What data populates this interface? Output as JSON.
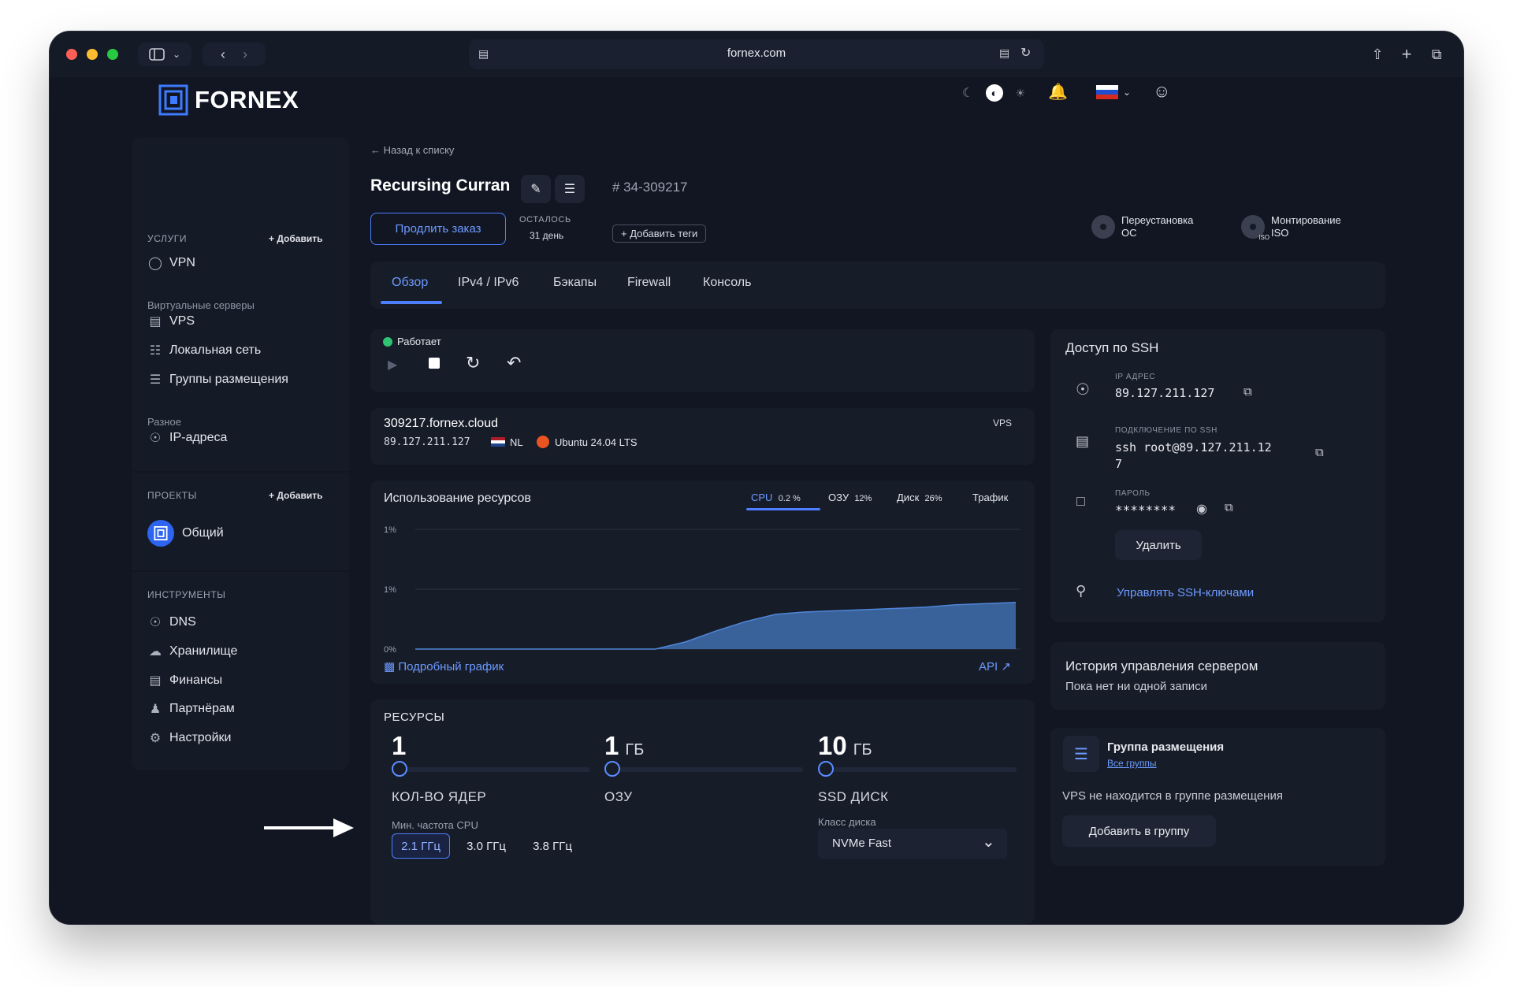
{
  "browser": {
    "url": "fornex.com"
  },
  "brand": {
    "name": "FORNEX"
  },
  "sidebar": {
    "services_head": "УСЛУГИ",
    "services_add": "+ Добавить",
    "vpn": "VPN",
    "virtual_head": "Виртуальные серверы",
    "vps": "VPS",
    "lan": "Локальная сеть",
    "placement": "Группы размещения",
    "misc_head": "Разное",
    "ip": "IP-адреса",
    "projects_head": "ПРОЕКТЫ",
    "projects_add": "+ Добавить",
    "project_common": "Общий",
    "tools_head": "ИНСТРУМЕНТЫ",
    "dns": "DNS",
    "storage": "Хранилище",
    "finance": "Финансы",
    "partners": "Партнёрам",
    "settings": "Настройки"
  },
  "header": {
    "back": "Назад к списку",
    "server_name": "Recursing Curran",
    "order_id": "# 34-309217",
    "extend": "Продлить заказ",
    "remain_label": "ОСТАЛОСЬ",
    "remain_value": "31 день",
    "add_tags": "+ Добавить теги",
    "reinstall_1": "Переустановка",
    "reinstall_2": "ОС",
    "mount_1": "Монтирование",
    "mount_2": "ISO",
    "iso_badge": "ISO"
  },
  "tabs": [
    "Обзор",
    "IPv4 / IPv6",
    "Бэкапы",
    "Firewall",
    "Консоль"
  ],
  "status": {
    "text": "Работает"
  },
  "server": {
    "host": "309217.fornex.cloud",
    "ip": "89.127.211.127",
    "country": "NL",
    "os": "Ubuntu 24.04 LTS",
    "type": "VPS"
  },
  "usage": {
    "title": "Использование ресурсов",
    "tabs": [
      {
        "label": "CPU",
        "value": "0.2 %"
      },
      {
        "label": "ОЗУ",
        "value": "12%"
      },
      {
        "label": "Диск",
        "value": "26%"
      },
      {
        "label": "Трафик",
        "value": ""
      }
    ],
    "detail_link": "Подробный график",
    "api_link": "API"
  },
  "chart_data": {
    "type": "area",
    "title": "",
    "y_tick_labels": [
      "1%",
      "1%",
      "0%"
    ],
    "ylim": [
      0,
      1
    ],
    "x": [
      0,
      0.1,
      0.2,
      0.3,
      0.4,
      0.45,
      0.5,
      0.55,
      0.6,
      0.65,
      0.7,
      0.75,
      0.8,
      0.85,
      0.9,
      0.95,
      1.0
    ],
    "series": [
      {
        "values": [
          0,
          0,
          0,
          0,
          0,
          0.06,
          0.15,
          0.23,
          0.29,
          0.31,
          0.32,
          0.33,
          0.34,
          0.35,
          0.37,
          0.38,
          0.39
        ]
      }
    ],
    "grid": true
  },
  "resources": {
    "title": "РЕСУРСЫ",
    "cores_value": "1",
    "cores_label": "КОЛ-ВО ЯДЕР",
    "ram_value": "1",
    "ram_unit": "ГБ",
    "ram_label": "ОЗУ",
    "disk_value": "10",
    "disk_unit": "ГБ",
    "disk_label": "SSD ДИСК",
    "freq_label": "Мин. частота CPU",
    "freq": [
      "2.1 ГГц",
      "3.0 ГГц",
      "3.8 ГГц"
    ],
    "disk_class_label": "Класс диска",
    "disk_class": "NVMe Fast"
  },
  "ssh": {
    "title": "Доступ по SSH",
    "ip_label": "IP АДРЕС",
    "ip": "89.127.211.127",
    "conn_label": "ПОДКЛЮЧЕНИЕ ПО SSH",
    "conn_1": "ssh root@89.127.211.12",
    "conn_2": "7",
    "pass_label": "ПАРОЛЬ",
    "pass": "********",
    "delete": "Удалить",
    "manage_keys": "Управлять SSH-ключами"
  },
  "history": {
    "title": "История управления сервером",
    "empty": "Пока нет ни одной записи"
  },
  "placement": {
    "title": "Группа размещения",
    "all_groups": "Все группы",
    "text": "VPS не находится в группе размещения",
    "add": "Добавить в группу"
  },
  "colors": {
    "accent": "#5b8cff",
    "bg": "#121623",
    "card": "#171c29",
    "status_ok": "#2fc473"
  }
}
